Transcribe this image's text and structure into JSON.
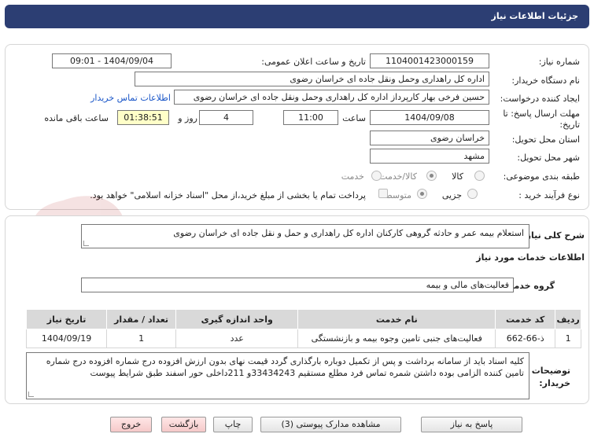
{
  "header": {
    "title": "جزئیات اطلاعات نیاز"
  },
  "info": {
    "need_number_label": "شماره نیاز:",
    "need_number": "1104001423000159",
    "announce_label": "تاریخ و ساعت اعلان عمومی:",
    "announce_value": "1404/09/04 - 09:01",
    "buyer_org_label": "نام دستگاه خریدار:",
    "buyer_org": "اداره کل راهداری وحمل ونقل جاده ای خراسان رضوی",
    "creator_label": "ایجاد کننده درخواست:",
    "creator": "حسین فرخی بهار کارپرداز اداره کل راهداری وحمل ونقل جاده ای خراسان رضوی",
    "contact_link": "اطلاعات تماس خریدار",
    "deadline_label_1": "مهلت ارسال پاسخ: تا",
    "deadline_label_2": "تاریخ:",
    "deadline_date": "1404/09/08",
    "time_label": "ساعت",
    "deadline_time": "11:00",
    "days_label": "روز و",
    "days_value": "4",
    "remaining_time": "01:38:51",
    "remaining_label": "ساعت باقی مانده",
    "province_label": "استان محل تحویل:",
    "province": "خراسان رضوی",
    "city_label": "شهر محل تحویل:",
    "city": "مشهد",
    "category_label": "طبقه بندی موضوعی:",
    "category_options": [
      "کالا",
      "کالا/خدمت"
    ],
    "process_label": "نوع فرآیند خرید :",
    "process_options": [
      "جزیی",
      "متوسط"
    ],
    "payment_note": "پرداخت تمام یا بخشی از مبلغ خرید،از محل \"اسناد خزانه اسلامی\" خواهد بود."
  },
  "details": {
    "summary_label": "شرح کلی نیاز:",
    "summary": "استعلام بیمه عمر و حادثه گروهی کارکنان اداره کل راهداری و حمل و نقل جاده ای خراسان رضوی",
    "services_heading": "اطلاعات خدمات مورد نیاز",
    "service_group_label": "گروه خدمت:",
    "service_group": "فعالیت‌های مالی و بیمه",
    "table": {
      "headers": [
        "ردیف",
        "کد خدمت",
        "نام خدمت",
        "واحد اندازه گیری",
        "تعداد / مقدار",
        "تاریخ نیاز"
      ],
      "rows": [
        [
          "1",
          "ذ-66-662",
          "فعالیت‌های جنبی تامین وجوه بیمه و بازنشستگی",
          "عدد",
          "1",
          "1404/09/19"
        ]
      ]
    },
    "buyer_notes_label_1": "توضیحات",
    "buyer_notes_label_2": "خریدار:",
    "buyer_notes": "کلیه اسناد باید از سامانه برداشت و پس از تکمیل دوباره بارگذاری گردد قیمت نهای بدون ارزش افزوده درج شماره افزوده درج شماره تامین کننده الزامی بوده داشتن   شمره تماس فرد مطلع مستقیم 33434243و 211داخلی  حور اسفند طبق شرایط پیوست"
  },
  "buttons": {
    "reply": "پاسخ به نیاز",
    "attachments": "مشاهده مدارک پیوستی (3)",
    "print": "چاپ",
    "back": "بازگشت",
    "exit": "خروج"
  },
  "colors": {
    "header_bg": "#2c3e73",
    "link": "#1a56c8",
    "timer_bg": "#ffffc8"
  }
}
